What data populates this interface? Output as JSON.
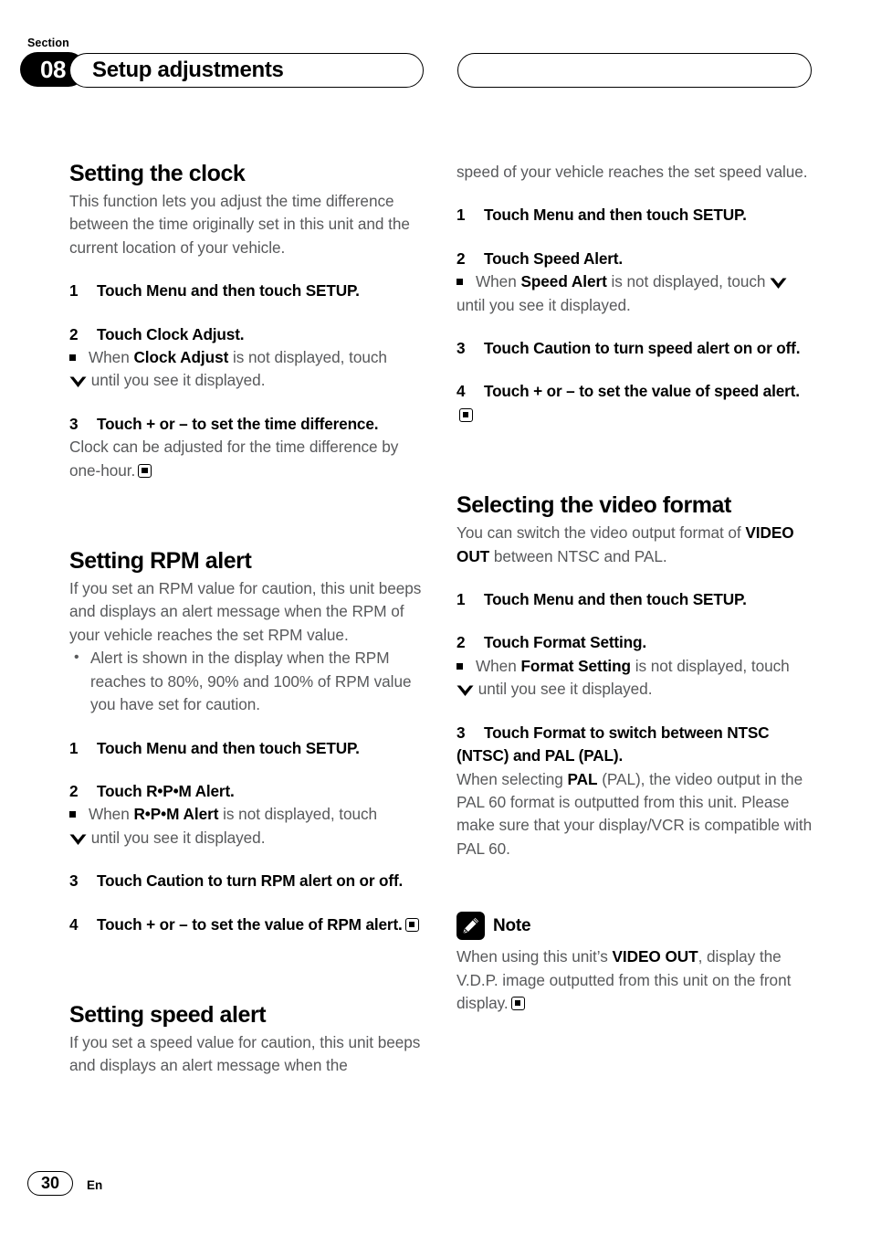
{
  "header": {
    "section_word": "Section",
    "section_number": "08",
    "title": "Setup adjustments",
    "right_pill_text": ""
  },
  "left_column": {
    "clock": {
      "heading": "Setting the clock",
      "intro": "This function lets you adjust the time difference between the time originally set in this unit and the current location of your vehicle.",
      "step1_num": "1",
      "step1_text": "Touch Menu and then touch SETUP.",
      "step2_num": "2",
      "step2_text": "Touch Clock Adjust.",
      "step2_sub_a": "When ",
      "step2_sub_b": "Clock Adjust",
      "step2_sub_c": " is not displayed, touch",
      "step2_sub_d": " until you see it displayed.",
      "step3_num": "3",
      "step3_text": "Touch + or – to set the time difference.",
      "step3_body": "Clock can be adjusted for the time difference by one-hour."
    },
    "rpm": {
      "heading": "Setting RPM alert",
      "intro": "If you set an RPM value for caution, this unit beeps and displays an alert message when the RPM of your vehicle reaches the set RPM value.",
      "bullet1": "Alert is shown in the display when the RPM reaches to 80%, 90% and 100% of RPM value you have set for caution.",
      "step1_num": "1",
      "step1_text": "Touch Menu and then touch SETUP.",
      "step2_num": "2",
      "step2_text": "Touch R•P•M Alert.",
      "step2_sub_a": "When ",
      "step2_sub_b": "R•P•M Alert",
      "step2_sub_c": " is not displayed, touch",
      "step2_sub_d": " until you see it displayed.",
      "step3_num": "3",
      "step3_text": "Touch Caution to turn RPM alert on or off.",
      "step4_num": "4",
      "step4_text": "Touch + or – to set the value of RPM alert."
    },
    "speed": {
      "heading": "Setting speed alert",
      "intro": "If you set a speed value for caution, this unit beeps and displays an alert message when the"
    }
  },
  "right_column": {
    "speed_cont": {
      "intro_cont": "speed of your vehicle reaches the set speed value.",
      "step1_num": "1",
      "step1_text": "Touch Menu and then touch SETUP.",
      "step2_num": "2",
      "step2_text": "Touch Speed Alert.",
      "step2_sub_a": "When ",
      "step2_sub_b": "Speed Alert",
      "step2_sub_c": " is not displayed, touch ",
      "step2_sub_d": "until you see it displayed.",
      "step3_num": "3",
      "step3_text": "Touch Caution to turn speed alert on or off.",
      "step4_num": "4",
      "step4_text": "Touch + or – to set the value of speed alert."
    },
    "video": {
      "heading": "Selecting the video format",
      "intro_a": "You can switch the video output format of ",
      "intro_b": "VIDEO OUT",
      "intro_c": " between NTSC and PAL.",
      "step1_num": "1",
      "step1_text": "Touch Menu and then touch SETUP.",
      "step2_num": "2",
      "step2_text": "Touch Format Setting.",
      "step2_sub_a": "When ",
      "step2_sub_b": "Format Setting",
      "step2_sub_c": " is not displayed, touch",
      "step2_sub_d": " until you see it displayed.",
      "step3_num": "3",
      "step3_text": "Touch Format to switch between NTSC (NTSC) and PAL (PAL).",
      "step3_body_a": "When selecting ",
      "step3_body_b": "PAL",
      "step3_body_c": " (PAL), the video output in the PAL 60 format is outputted from this unit. Please make sure that your display/VCR is compatible with PAL 60."
    },
    "note": {
      "label": "Note",
      "text_a": "When using this unit’s ",
      "text_b": "VIDEO OUT",
      "text_c": ", display the V.D.P. image outputted from this unit on the front display."
    }
  },
  "footer": {
    "page_number": "30",
    "language_code": "En"
  },
  "colors": {
    "body_text": "#58595b",
    "heading_text": "#000000",
    "badge_background": "#000000"
  }
}
